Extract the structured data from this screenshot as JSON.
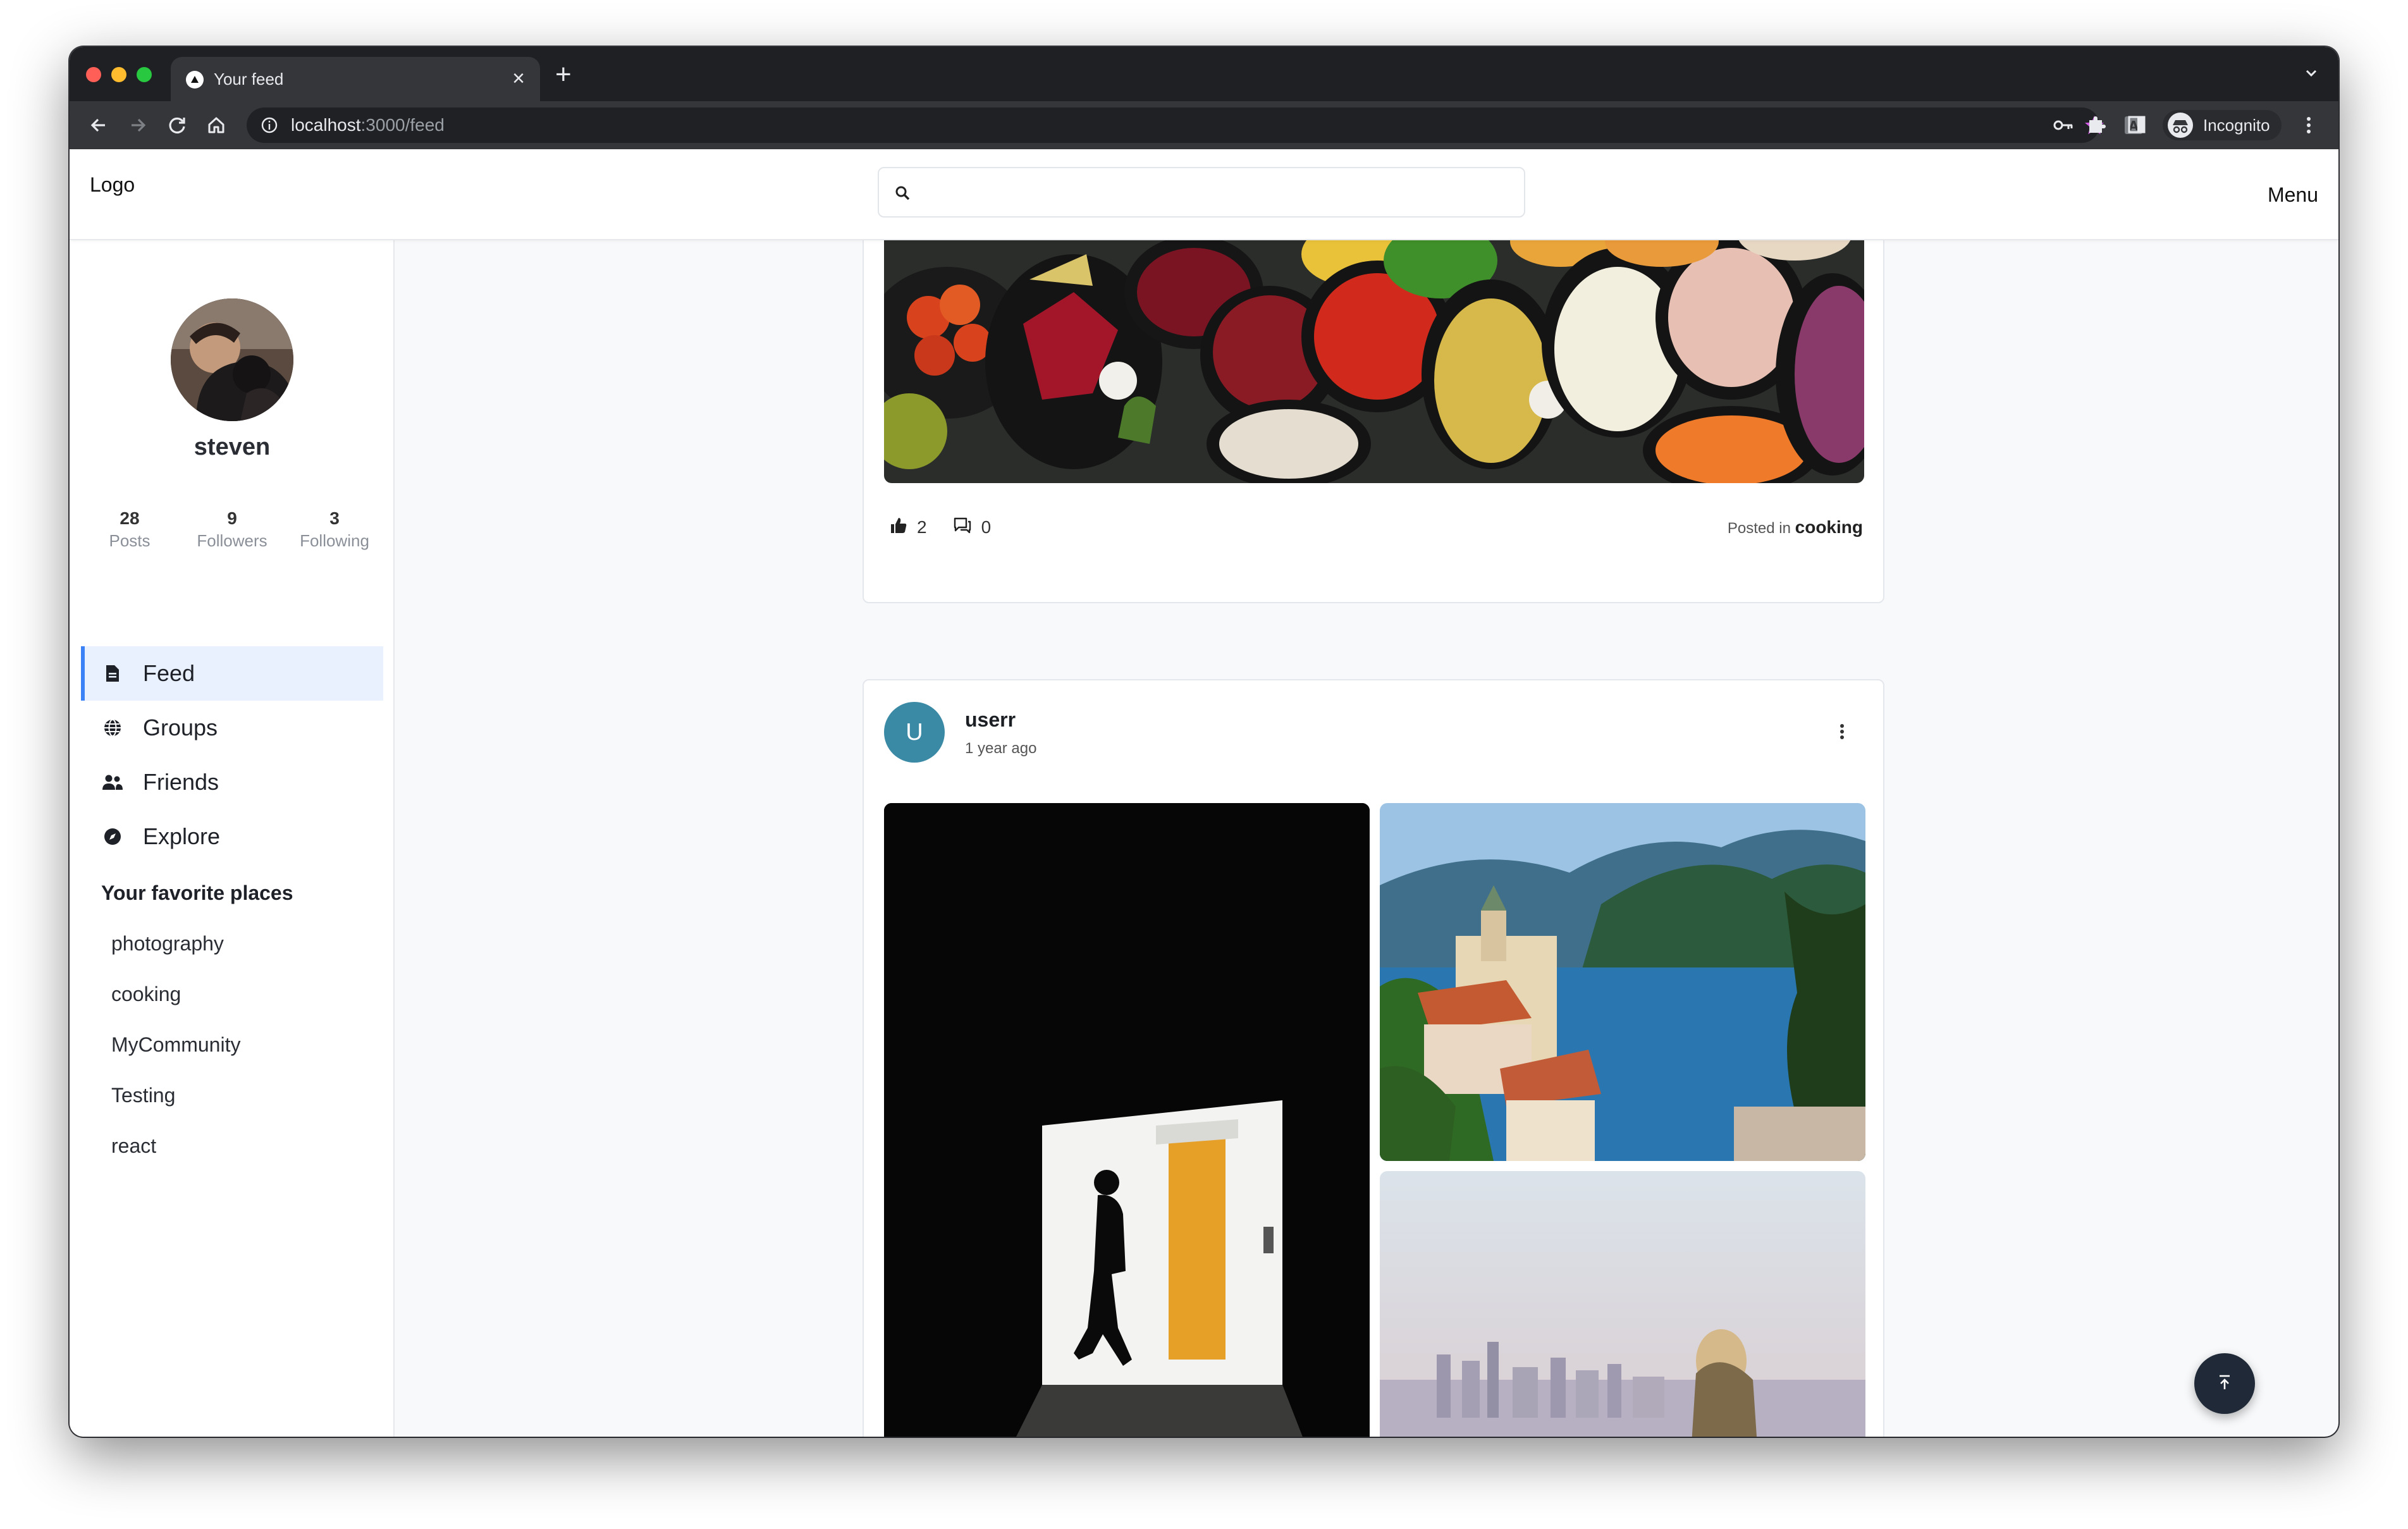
{
  "browser": {
    "tab_title": "Your feed",
    "url_host": "localhost",
    "url_path": ":3000/feed",
    "profile_label": "Incognito"
  },
  "header": {
    "logo": "Logo",
    "search_placeholder": "",
    "menu_label": "Menu"
  },
  "profile": {
    "username": "steven",
    "stats": [
      {
        "value": "28",
        "label": "Posts"
      },
      {
        "value": "9",
        "label": "Followers"
      },
      {
        "value": "3",
        "label": "Following"
      }
    ]
  },
  "nav": {
    "items": [
      {
        "label": "Feed",
        "icon": "document-icon",
        "active": true
      },
      {
        "label": "Groups",
        "icon": "globe-icon"
      },
      {
        "label": "Friends",
        "icon": "users-icon"
      },
      {
        "label": "Explore",
        "icon": "compass-icon"
      }
    ]
  },
  "favorites": {
    "heading": "Your favorite places",
    "items": [
      "photography",
      "cooking",
      "MyCommunity",
      "Testing",
      "react"
    ]
  },
  "posts": [
    {
      "likes": "2",
      "comments": "0",
      "posted_in_label": "Posted in",
      "community": "cooking"
    },
    {
      "author_initial": "U",
      "author": "userr",
      "time": "1 year ago"
    }
  ],
  "colors": {
    "accent": "#3b82f6",
    "active_nav_bg": "#e8f1fd",
    "avatar_bg": "#3b8aa5",
    "fab_bg": "#1f2937"
  }
}
